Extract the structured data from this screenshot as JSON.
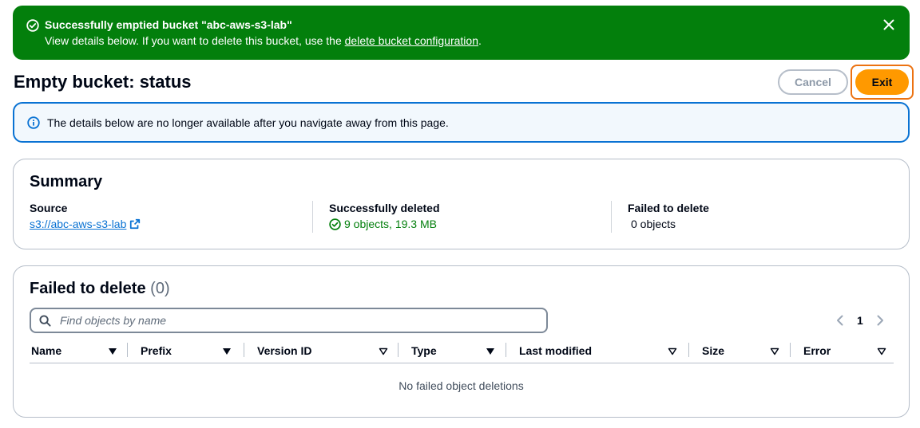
{
  "flash": {
    "title": "Successfully emptied bucket \"abc-aws-s3-lab\"",
    "body_prefix": "View details below. If you want to delete this bucket, use the ",
    "link": "delete bucket configuration",
    "body_suffix": ".",
    "icon": "check-circle-icon",
    "close_icon": "close-icon",
    "color": "#037f0c"
  },
  "header": {
    "title": "Empty bucket: status",
    "cancel_label": "Cancel",
    "exit_label": "Exit"
  },
  "info_alert": {
    "text": "The details below are no longer available after you navigate away from this page.",
    "icon": "info-icon"
  },
  "summary": {
    "title": "Summary",
    "source_label": "Source",
    "source_value": "s3://abc-aws-s3-lab",
    "deleted_label": "Successfully deleted",
    "deleted_value": "9 objects, 19.3 MB",
    "failed_label": "Failed to delete",
    "failed_value": "0 objects"
  },
  "failed_table": {
    "title": "Failed to delete",
    "count": "(0)",
    "search_placeholder": "Find objects by name",
    "page": "1",
    "columns": [
      "Name",
      "Prefix",
      "Version ID",
      "Type",
      "Last modified",
      "Size",
      "Error"
    ],
    "empty_message": "No failed object deletions"
  }
}
